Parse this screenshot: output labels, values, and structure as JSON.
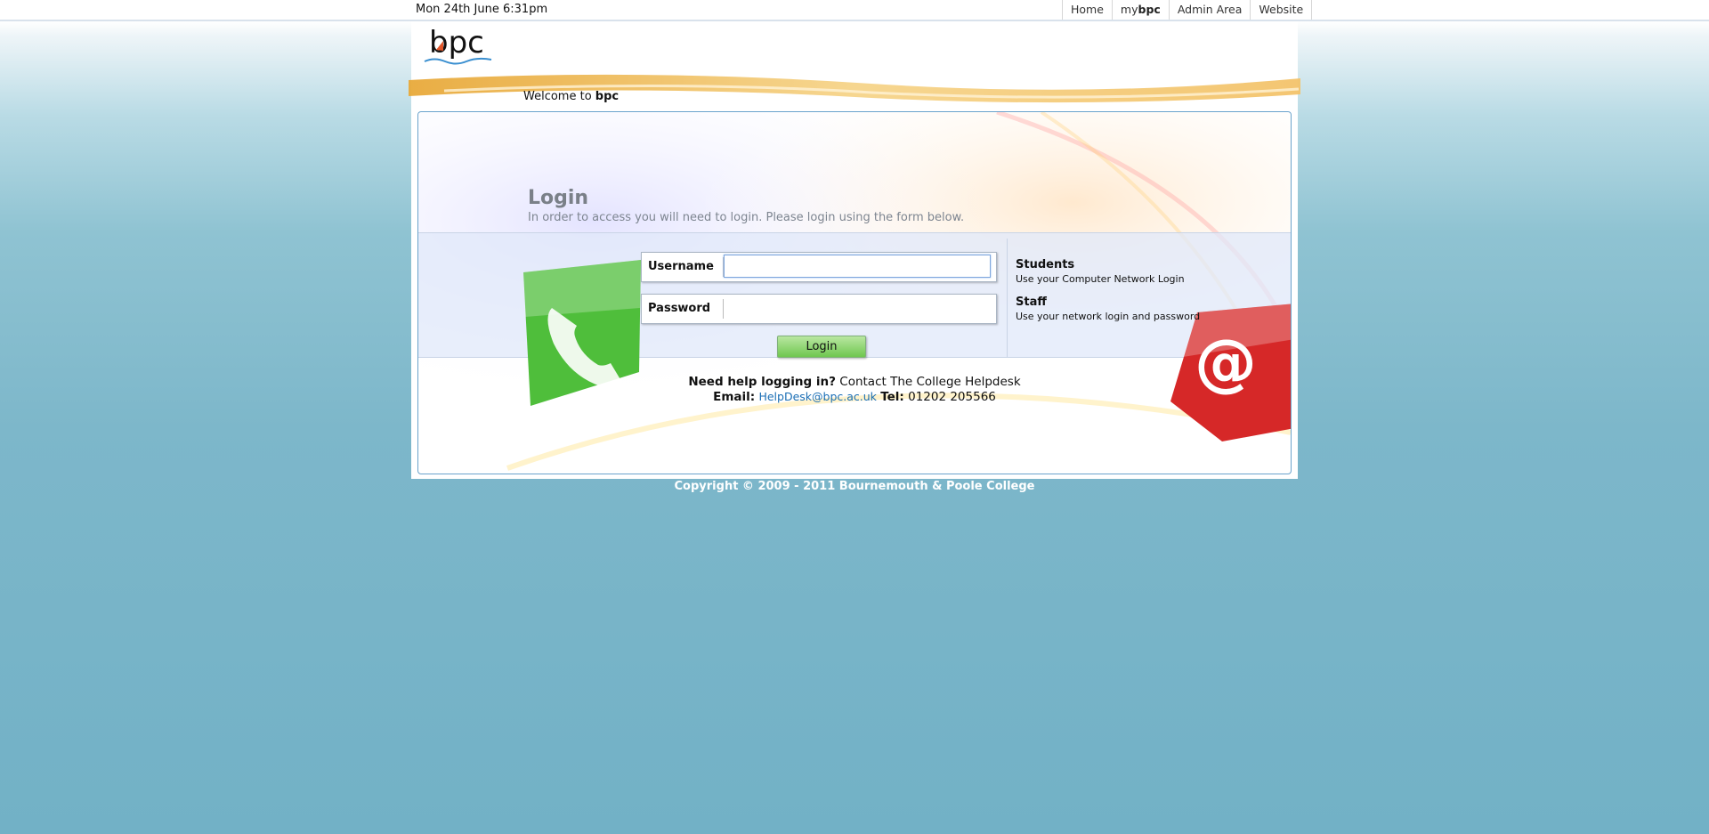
{
  "topbar": {
    "date": "Mon 24th June 6:31pm",
    "nav": {
      "home": "Home",
      "mybpc_prefix": "my",
      "mybpc_bold": "bpc",
      "admin": "Admin Area",
      "website": "Website"
    }
  },
  "header": {
    "logo_text": "bpc",
    "welcome_prefix": "Welcome to ",
    "welcome_bold": "bpc"
  },
  "login": {
    "title": "Login",
    "subtitle": "In order to access you will need to login. Please login using the form below.",
    "username_label": "Username",
    "username_value": "",
    "password_label": "Password",
    "password_value": "",
    "button": "Login"
  },
  "info": {
    "students_title": "Students",
    "students_desc": "Use your Computer Network Login",
    "staff_title": "Staff",
    "staff_desc": "Use your network login and password"
  },
  "help": {
    "question": "Need help logging in?",
    "contact": " Contact The College Helpdesk",
    "email_label": "Email:",
    "email": "HelpDesk@bpc.ac.uk",
    "tel_label": "Tel:",
    "tel": "01202 205566"
  },
  "footer": {
    "copyright": "Copyright © 2009 - 2011 Bournemouth & Poole College"
  },
  "icons": {
    "phone": "phone-icon",
    "at": "at-sign-icon"
  },
  "colors": {
    "accent_orange": "#e8a93a",
    "panel_border": "#6aa3cc",
    "button_green": "#6fc74f",
    "link_blue": "#1a6eb5"
  }
}
